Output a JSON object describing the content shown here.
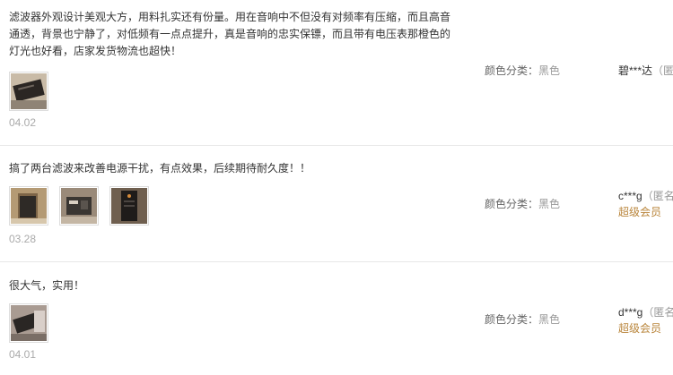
{
  "reviews": [
    {
      "content": "滤波器外观设计美观大方，用料扎实还有份量。用在音响中不但没有对频率有压缩，而且高音通透，背景也宁静了，对低频有一点点提升，真是音响的忠实保镖，而且带有电压表那橙色的灯光也好看，店家发货物流也超快！",
      "date": "04.02",
      "sku_label": "颜色分类：",
      "sku_value": "黑色",
      "user": "碧***达",
      "anon": "（匿名）",
      "vip": ""
    },
    {
      "content": "搞了两台滤波来改善电源干扰，有点效果，后续期待耐久度！！",
      "date": "03.28",
      "sku_label": "颜色分类：",
      "sku_value": "黑色",
      "user": "c***g",
      "anon": "（匿名）",
      "vip": "超级会员"
    },
    {
      "content": "很大气，实用！",
      "date": "04.01",
      "sku_label": "颜色分类：",
      "sku_value": "黑色",
      "user": "d***g",
      "anon": "（匿名）",
      "vip": "超级会员"
    }
  ]
}
